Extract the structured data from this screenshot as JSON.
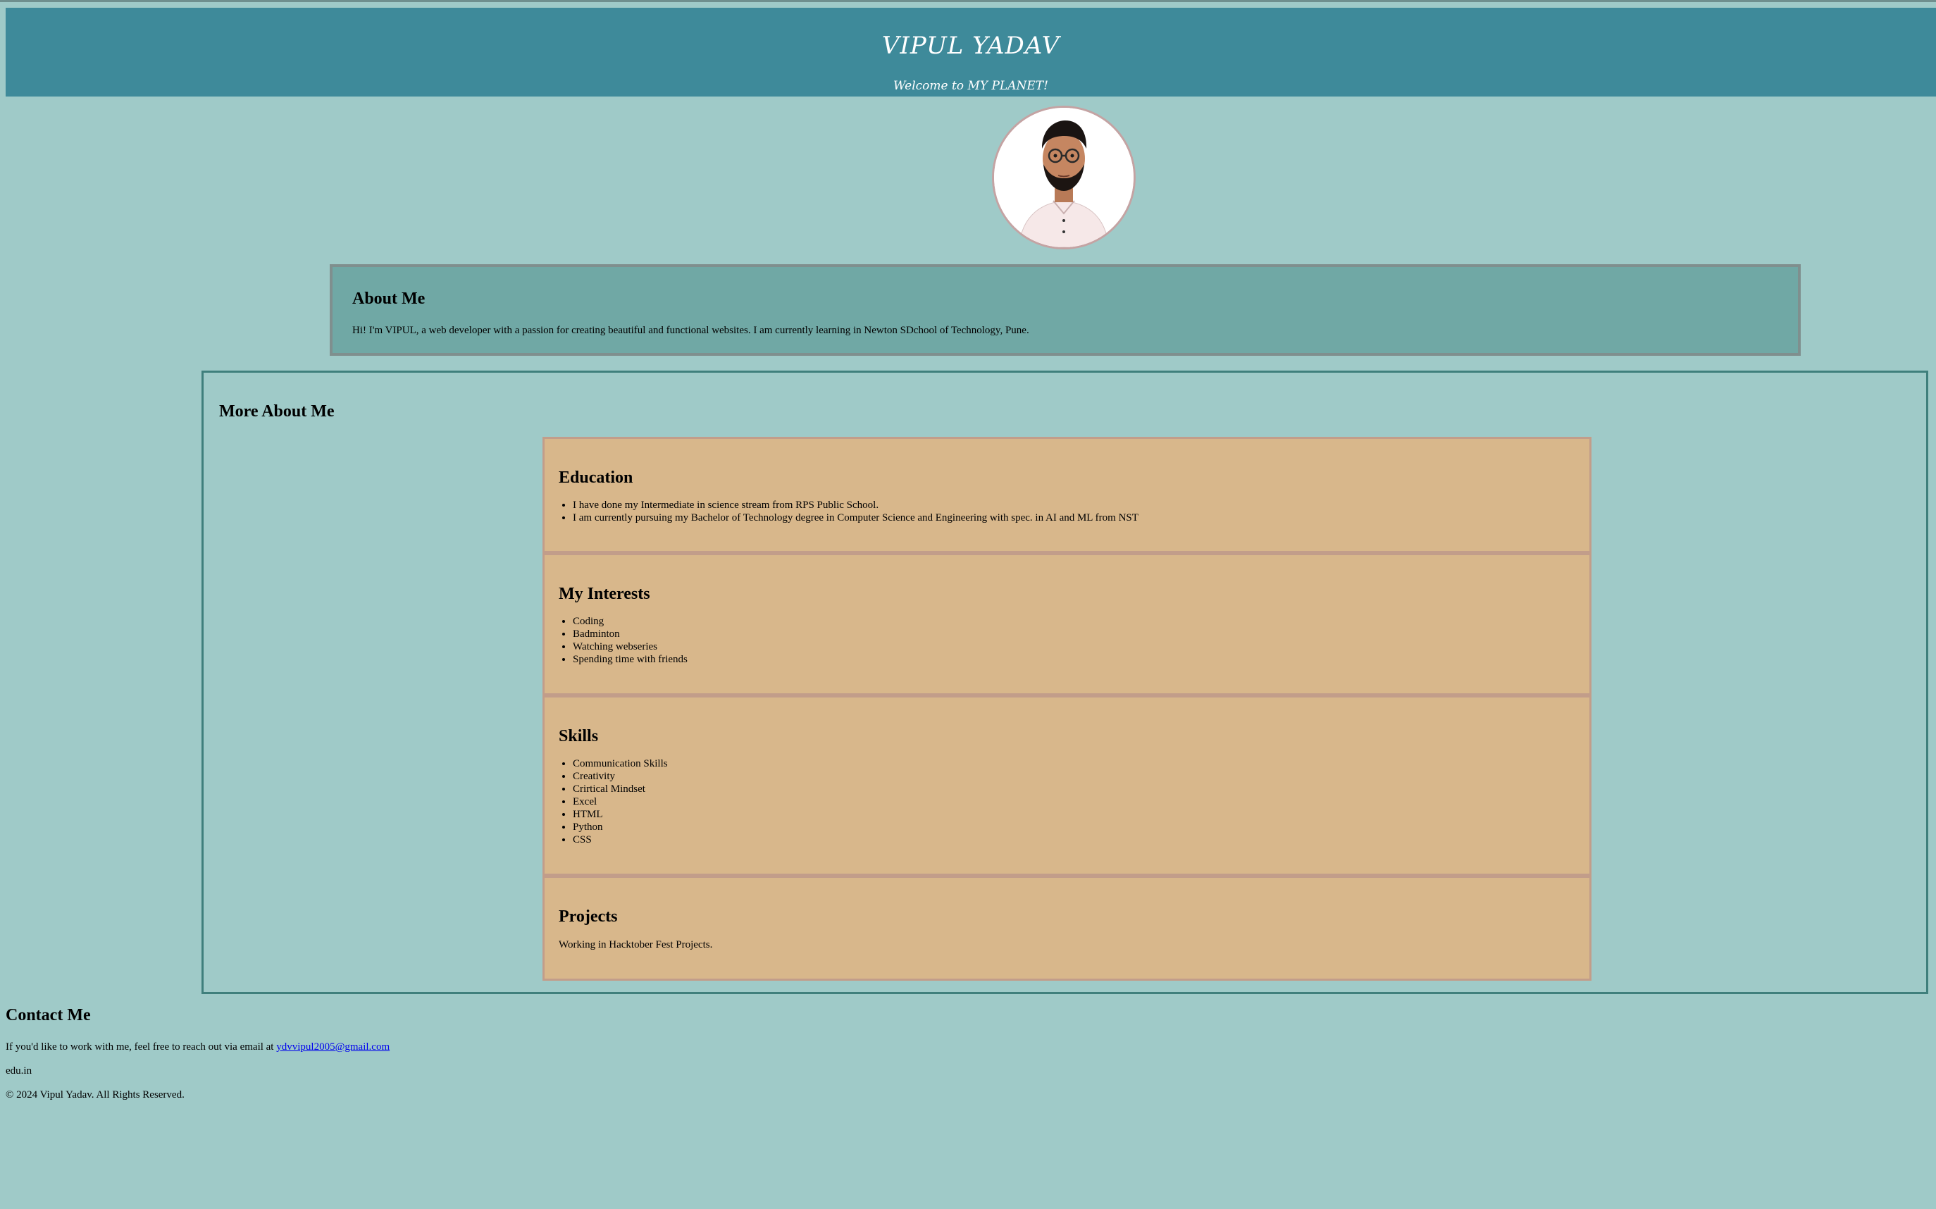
{
  "header": {
    "title": "VIPUL YADAV",
    "subtitle": "Welcome to MY PLANET!"
  },
  "profile": {
    "image_desc": "profile photo"
  },
  "about": {
    "heading": "About Me",
    "text": "Hi! I'm VIPUL, a web developer with a passion for creating beautiful and functional websites. I am currently learning in Newton SDchool of Technology, Pune."
  },
  "more": {
    "heading": "More About Me",
    "education": {
      "heading": "Education",
      "items": [
        "I have done my Intermediate in science stream from RPS Public School.",
        "I am currently pursuing my Bachelor of Technology degree in Computer Science and Engineering with spec. in AI and ML from NST"
      ]
    },
    "interests": {
      "heading": "My Interests",
      "items": [
        "Coding",
        "Badminton",
        "Watching webseries",
        "Spending time with friends"
      ]
    },
    "skills": {
      "heading": "Skills",
      "items": [
        "Communication Skills",
        "Creativity",
        "Crirtical Mindset",
        "Excel",
        "HTML",
        "Python",
        "CSS"
      ]
    },
    "projects": {
      "heading": "Projects",
      "text": "Working in Hacktober Fest Projects."
    }
  },
  "contact": {
    "heading": "Contact Me",
    "text_before_link": "If you'd like to work with me, feel free to reach out via email at ",
    "email": "ydvvipul2005@gmail.com",
    "extra": "edu.in",
    "footer": "© 2024 Vipul Yadav. All Rights Reserved."
  }
}
